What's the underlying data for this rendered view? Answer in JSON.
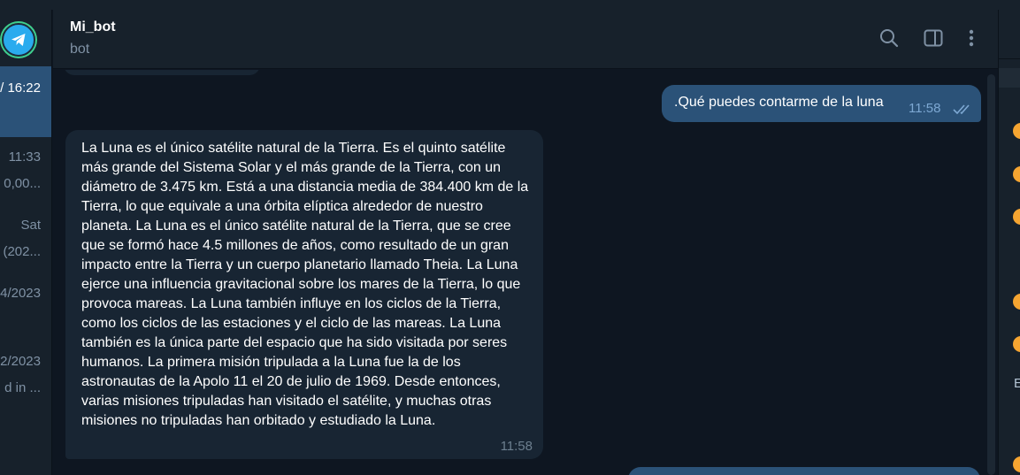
{
  "header": {
    "title": "Mi_bot",
    "subtitle": "bot"
  },
  "header_icons": [
    "search-icon",
    "sidebar-toggle-icon",
    "more-vertical-icon"
  ],
  "left_panel": {
    "items": [
      {
        "text": "/ 16:22"
      },
      {
        "text": "11:33"
      },
      {
        "text": "0,00..."
      },
      {
        "text": "Sat"
      },
      {
        "text": "(202..."
      },
      {
        "text": "4/2023"
      },
      {
        "text": "2/2023"
      },
      {
        "text": "d in ..."
      }
    ]
  },
  "messages": {
    "out1": {
      "text": ".Qué puedes contarme de la luna",
      "time": "11:58"
    },
    "in1": {
      "text": "La Luna es el único satélite natural de la Tierra. Es el quinto satélite más grande del Sistema Solar y el más grande de la Tierra, con un diámetro de 3.475 km. Está a una distancia media de 384.400 km de la Tierra, lo que equivale a una órbita elíptica alrededor de nuestro planeta. La Luna es el único satélite natural de la Tierra, que se cree que se formó hace 4.5 millones de años, como resultado de un gran impacto entre la Tierra y un cuerpo planetario llamado Theia. La Luna ejerce una influencia gravitacional sobre los mares de la Tierra, lo que provoca mareas. La Luna también influye en los ciclos de la Tierra, como los ciclos de las estaciones y el ciclo de las mareas. La Luna también es la única parte del espacio que ha sido visitada por seres humanos. La primera misión tripulada a la Luna fue la de los astronautas de la Apolo 11 el 20 de julio de 1969. Desde entonces, varias misiones tripuladas han visitado el satélite, y muchas otras misiones no tripuladas han orbitado y estudiado la Luna.",
      "time": "11:58"
    }
  },
  "right_panel": {
    "letter": "E"
  },
  "colors": {
    "background": "#0e1621",
    "panel": "#17212b",
    "outgoing_bubble": "#2b5278",
    "incoming_bubble": "#182533",
    "muted_text": "#7f91a4",
    "accent": "#2aabee"
  }
}
